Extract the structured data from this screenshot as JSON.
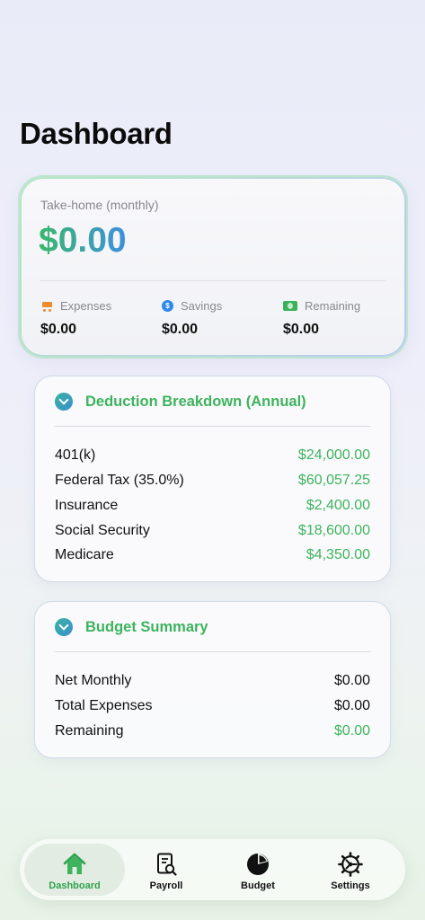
{
  "page": {
    "title": "Dashboard"
  },
  "summary": {
    "label": "Take-home (monthly)",
    "amount": "$0.00",
    "stats": [
      {
        "icon": "cart-icon",
        "label": "Expenses",
        "value": "$0.00"
      },
      {
        "icon": "dollar-coin-icon",
        "label": "Savings",
        "value": "$0.00"
      },
      {
        "icon": "banknote-icon",
        "label": "Remaining",
        "value": "$0.00"
      }
    ]
  },
  "deductions": {
    "title": "Deduction Breakdown (Annual)",
    "rows": [
      {
        "label": "401(k)",
        "value": "$24,000.00"
      },
      {
        "label": "Federal Tax (35.0%)",
        "value": "$60,057.25"
      },
      {
        "label": "Insurance",
        "value": "$2,400.00"
      },
      {
        "label": "Social Security",
        "value": "$18,600.00"
      },
      {
        "label": "Medicare",
        "value": "$4,350.00"
      }
    ]
  },
  "budget": {
    "title": "Budget Summary",
    "rows": [
      {
        "label": "Net Monthly",
        "value": "$0.00"
      },
      {
        "label": "Total Expenses",
        "value": "$0.00"
      },
      {
        "label": "Remaining",
        "value": "$0.00"
      }
    ]
  },
  "tabs": [
    {
      "label": "Dashboard",
      "icon": "house-icon",
      "active": true
    },
    {
      "label": "Payroll",
      "icon": "document-search-icon",
      "active": false
    },
    {
      "label": "Budget",
      "icon": "pie-chart-icon",
      "active": false
    },
    {
      "label": "Settings",
      "icon": "gear-icon",
      "active": false
    }
  ],
  "colors": {
    "accent_green": "#3db35d",
    "accent_blue": "#3d8fe0",
    "expense_orange": "#f08a2a"
  }
}
